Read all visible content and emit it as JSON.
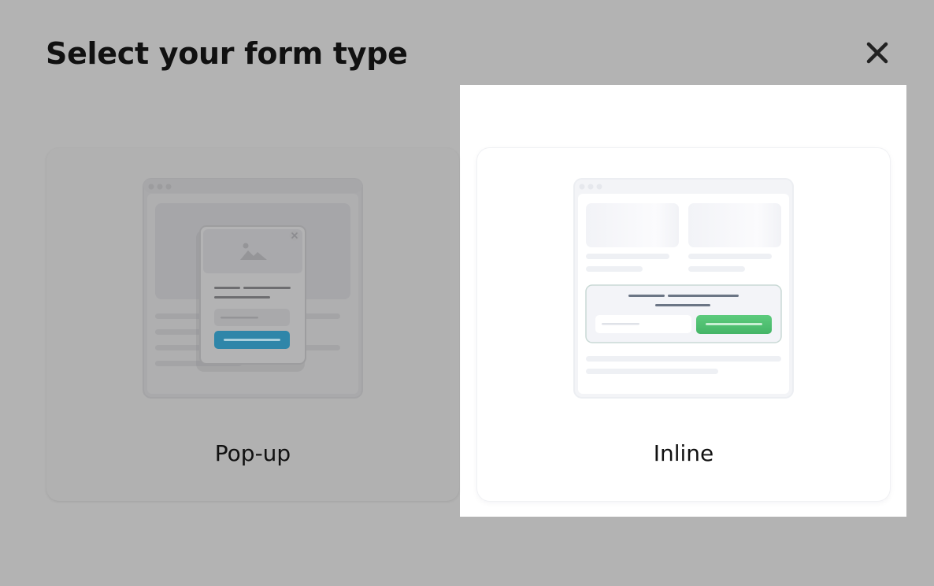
{
  "dialog": {
    "title": "Select your form type",
    "close_icon": "close-icon"
  },
  "options": [
    {
      "label": "Pop-up",
      "icon": "popup-form-illustration",
      "selected": false
    },
    {
      "label": "Inline",
      "icon": "inline-form-illustration",
      "selected": true
    }
  ],
  "colors": {
    "overlay": "#b3b3b3",
    "popup_button": "#2f86a9",
    "inline_button": "#4fbf72",
    "title_text": "#111111"
  }
}
